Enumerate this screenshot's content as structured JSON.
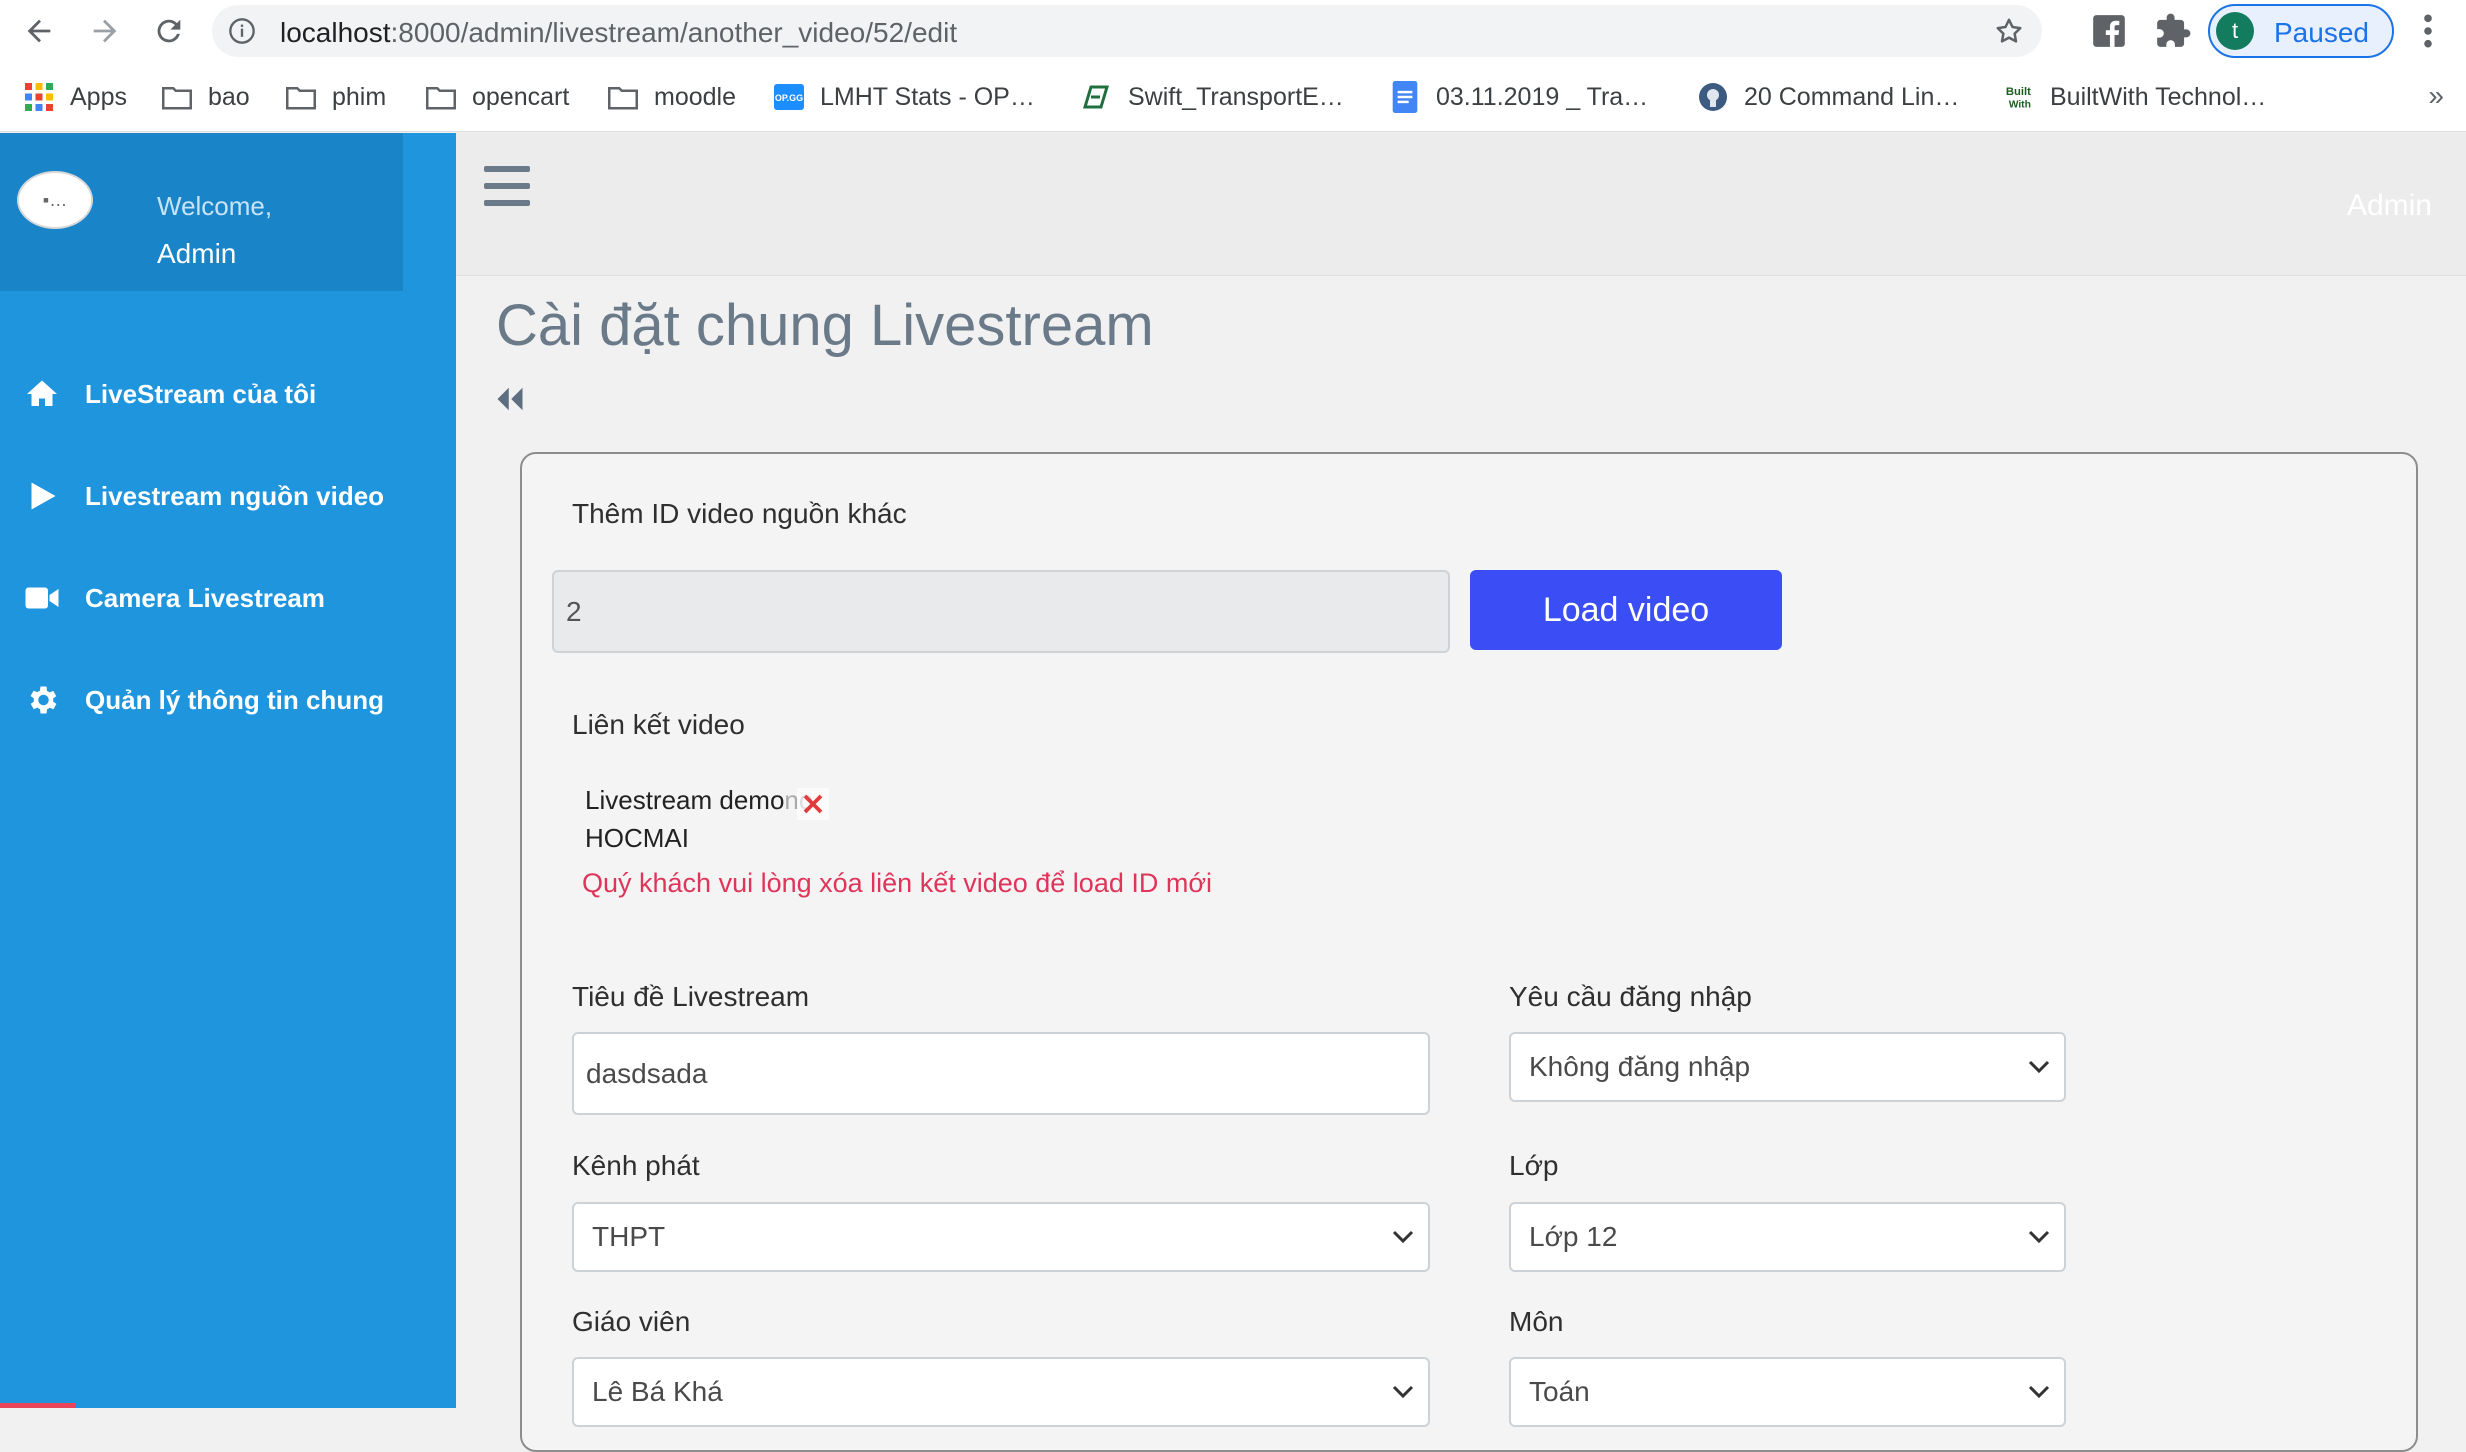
{
  "browser": {
    "url_host": "localhost",
    "url_path": ":8000/admin/livestream/another_video/52/edit",
    "profile_initial": "t",
    "profile_status": "Paused",
    "bookmarks": [
      {
        "label": "Apps",
        "icon": "apps-grid-icon"
      },
      {
        "label": "bao",
        "icon": "folder-icon"
      },
      {
        "label": "phim",
        "icon": "folder-icon"
      },
      {
        "label": "opencart",
        "icon": "folder-icon"
      },
      {
        "label": "moodle",
        "icon": "folder-icon"
      },
      {
        "label": "LMHT Stats - OP…",
        "icon": "opgg-icon"
      },
      {
        "label": "Swift_TransportE…",
        "icon": "laravel-icon"
      },
      {
        "label": "03.11.2019 _ Tra…",
        "icon": "docs-icon"
      },
      {
        "label": "20 Command Lin…",
        "icon": "site-icon"
      },
      {
        "label": "BuiltWith Technol…",
        "icon": "builtwith-icon"
      }
    ],
    "bookmarks_more": "»"
  },
  "sidebar": {
    "avatar_alt": "…",
    "welcome": "Welcome,",
    "user": "Admin",
    "items": [
      {
        "label": "LiveStream của tôi",
        "icon": "home-icon"
      },
      {
        "label": "Livestream nguồn video",
        "icon": "play-icon"
      },
      {
        "label": "Camera Livestream",
        "icon": "video-camera-icon"
      },
      {
        "label": "Quản lý thông tin chung",
        "icon": "gear-icon"
      }
    ]
  },
  "header": {
    "admin_label": "Admin"
  },
  "page": {
    "title": "Cài đặt chung Livestream"
  },
  "form": {
    "add_id_label": "Thêm ID video nguồn khác",
    "video_id_value": "2",
    "load_button": "Load video",
    "video_link_label": "Liên kết video",
    "video_title": "Livestream demo",
    "video_title_tail": "no",
    "video_channel": "HOCMAI",
    "warning": "Quý khách vui lòng xóa liên kết video để load ID mới",
    "title_label": "Tiêu đề Livestream",
    "title_value": "dasdsada",
    "login_label": "Yêu cầu đăng nhập",
    "login_value": "Không đăng nhập",
    "channel_label": "Kênh phát",
    "channel_value": "THPT",
    "grade_label": "Lớp",
    "grade_value": "Lớp 12",
    "teacher_label": "Giáo viên",
    "teacher_value": "Lê Bá Khá",
    "subject_label": "Môn",
    "subject_value": "Toán"
  },
  "colors": {
    "sidebar": "#1f95dd",
    "primary_button": "#3b4ef5",
    "warning_text": "#e0355a"
  }
}
